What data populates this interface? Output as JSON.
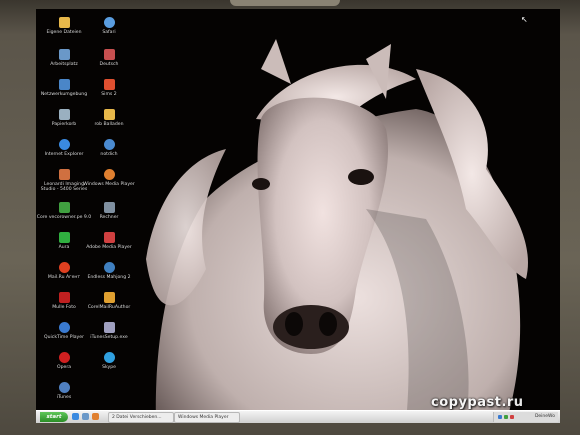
{
  "desktop": {
    "icons": [
      {
        "label": "Eigene Dateien",
        "color": "#e8b84a"
      },
      {
        "label": "Safari",
        "color": "#5a9de0"
      },
      {
        "label": "Arbeitsplatz",
        "color": "#6a98c8"
      },
      {
        "label": "Deutsch",
        "color": "#c85050"
      },
      {
        "label": "Netzwerkumgebung",
        "color": "#4a86c8"
      },
      {
        "label": "Sims 2",
        "color": "#e05030"
      },
      {
        "label": "Papierkorb",
        "color": "#9ab0c0"
      },
      {
        "label": "rob Balladen",
        "color": "#e8b84a"
      },
      {
        "label": "Internet Explorer",
        "color": "#3a8ae0"
      },
      {
        "label": "notdich",
        "color": "#4a8ad0"
      },
      {
        "label": "Leonardi Imaging Studio - 5400 Series",
        "color": "#d07040"
      },
      {
        "label": "Windows Media Player",
        "color": "#e08030"
      },
      {
        "label": "Core vecorowner.pe 9.0",
        "color": "#40a040"
      },
      {
        "label": "Rechner",
        "color": "#8090a0"
      },
      {
        "label": "Aura",
        "color": "#30b040"
      },
      {
        "label": "Adobe Media Player",
        "color": "#d04040"
      },
      {
        "label": "Mail.Ru Агент",
        "color": "#e04020"
      },
      {
        "label": "Endless Mahjong 2",
        "color": "#4080c0"
      },
      {
        "label": "Mulle Foto",
        "color": "#c02020"
      },
      {
        "label": "CorelMailRuAuthor",
        "color": "#e0a030"
      },
      {
        "label": "QuickTime Player",
        "color": "#3a7ad0"
      },
      {
        "label": "iTunesSetup.exe",
        "color": "#a0a0c0"
      },
      {
        "label": "Opera",
        "color": "#d02020"
      },
      {
        "label": "Skype",
        "color": "#30a0e0"
      },
      {
        "label": "iTunes",
        "color": "#5080c0"
      }
    ]
  },
  "taskbar": {
    "start_label": "start",
    "buttons": [
      "2 Datei Verschieben...",
      "Windows Media Player"
    ],
    "clock": "DeineWo"
  },
  "watermark": "copypast.ru"
}
